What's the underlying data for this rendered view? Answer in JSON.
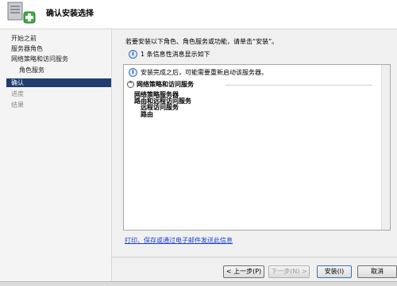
{
  "window": {
    "title": "确认安装选择"
  },
  "nav": {
    "items": [
      {
        "label": "开始之前"
      },
      {
        "label": "服务器角色"
      },
      {
        "label": "网络策略和访问服务"
      },
      {
        "label": "角色服务"
      },
      {
        "label": "确认"
      },
      {
        "label": "进度"
      },
      {
        "label": "结果"
      }
    ]
  },
  "main": {
    "intro": "若要安装以下角色、角色服务或功能，请单击“安装”。",
    "info_count": "1 条信息性消息显示如下",
    "notice": "安装完成之后，可能需要重新启动该服务器。",
    "section_title": "网络策略和访问服务",
    "items": [
      "网络策略服务器",
      "路由和远程访问服务",
      "远程访问服务",
      "路由"
    ],
    "link": "打印、保存或通过电子邮件发送此信息"
  },
  "buttons": {
    "back": "< 上一步(P)",
    "next": "下一步(N) >",
    "install": "安装(I)",
    "cancel": "取消"
  },
  "icons": {
    "header": "server-add-icon",
    "info": "info-icon"
  }
}
